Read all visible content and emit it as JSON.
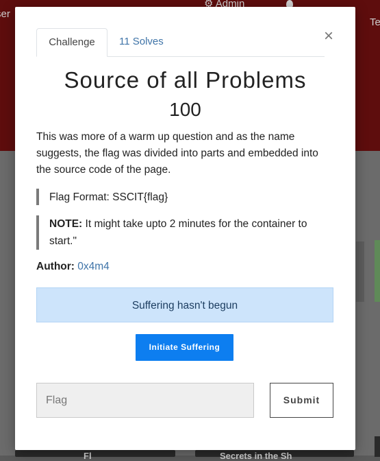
{
  "background": {
    "nav_left": "ser",
    "nav_admin": "⚙ Admin",
    "nav_right": "Te",
    "card_bottom_left": "Fl",
    "card_bottom_right": "Secrets in the Sh"
  },
  "modal": {
    "tabs": [
      {
        "label": "Challenge",
        "active": true
      },
      {
        "label": "11 Solves",
        "active": false
      }
    ],
    "close_label": "×",
    "title": "Source of all Problems",
    "points": "100",
    "description": "This was more of a warm up question and as the name suggests, the flag was divided into parts and embedded into the source code of the page.",
    "flag_format": "Flag Format: SSCIT{flag}",
    "note_label": "NOTE:",
    "note_text": " It might take upto 2 minutes for the container to start.\"",
    "author_label": "Author:",
    "author_name": "0x4m4",
    "status_text": "Suffering hasn't begun",
    "initiate_label": "Initiate Suffering",
    "flag_placeholder": "Flag",
    "flag_value": "",
    "submit_label": "Submit"
  },
  "colors": {
    "accent": "#0d7ef0",
    "status_bg": "#cde4fb",
    "link": "#3f74a8",
    "header_bg": "#5e0d0d"
  }
}
